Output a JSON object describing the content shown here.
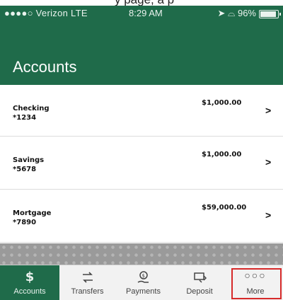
{
  "status_bar": {
    "carrier": "●●●●○ Verizon  LTE",
    "time": "8:29 AM",
    "battery": "96%"
  },
  "caption_fragment": "y page, a p",
  "header": {
    "title": "Accounts"
  },
  "accounts": [
    {
      "name": "Checking",
      "number": "*1234",
      "balance": "$1,000.00"
    },
    {
      "name": "Savings",
      "number": "*5678",
      "balance": "$1,000.00"
    },
    {
      "name": "Mortgage",
      "number": "*7890",
      "balance": "$59,000.00"
    }
  ],
  "tabs": [
    {
      "label": "Accounts",
      "icon": "dollar-icon",
      "active": true
    },
    {
      "label": "Transfers",
      "icon": "transfer-arrows-icon"
    },
    {
      "label": "Payments",
      "icon": "payment-hand-icon"
    },
    {
      "label": "Deposit",
      "icon": "check-deposit-icon"
    },
    {
      "label": "More",
      "icon": "more-dots-icon",
      "highlighted": true
    }
  ],
  "colors": {
    "brand_green": "#1f6b4a",
    "highlight_red": "#d62a2a"
  }
}
